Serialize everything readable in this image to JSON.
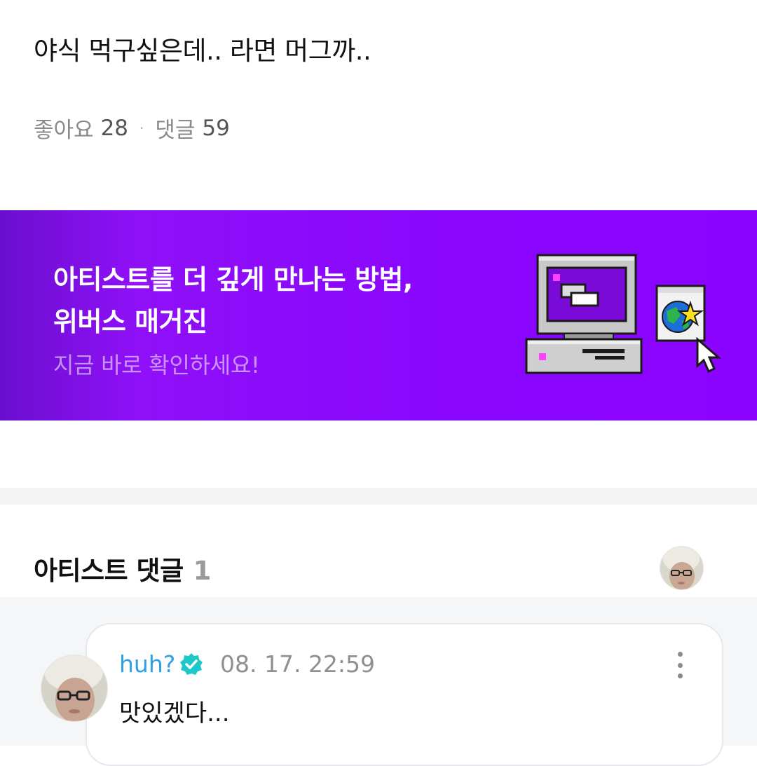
{
  "post": {
    "text": "야식 먹구싶은데.. 라면 머그까..",
    "likes_label": "좋아요",
    "likes_count": "28",
    "separator": "·",
    "comments_label": "댓글",
    "comments_count": "59"
  },
  "banner": {
    "line1": "아티스트를 더 깊게 만나는 방법,",
    "line2": "위버스 매거진",
    "cta": "지금 바로 확인하세요!",
    "background_color": "#8a03ff",
    "illustration_icons": [
      "retro-computer-icon",
      "globe-star-icon",
      "mouse-cursor-icon"
    ]
  },
  "artist_comments": {
    "title": "아티스트 댓글",
    "count": "1",
    "comments": [
      {
        "author": "huh?",
        "verified": true,
        "timestamp": "08. 17. 22:59",
        "body": "맛있겠다..."
      }
    ]
  },
  "colors": {
    "author_link": "#2ea0e6",
    "verified_badge": "#1ec8c8",
    "muted_text": "#8a8a8a"
  }
}
